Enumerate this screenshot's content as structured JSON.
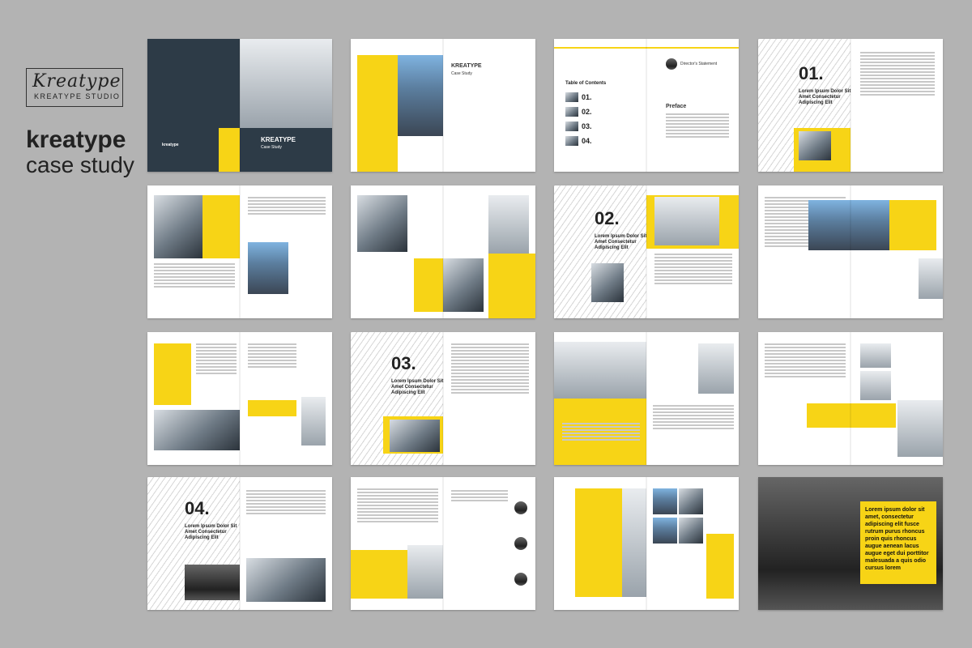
{
  "brand": {
    "logo_script": "Kreatype",
    "logo_sub": "KREATYPE STUDIO",
    "title_bold": "kreatype",
    "title_light": "case study"
  },
  "cover": {
    "name": "KREATYPE",
    "sub": "Case Study",
    "mini_brand": "kreatype"
  },
  "sections": [
    {
      "number": "01.",
      "heading": "Lorem Ipsum Dolor Sit Amet Consectetur Adipiscing Elit"
    },
    {
      "number": "02.",
      "heading": "Lorem Ipsum Dolor Sit Amet Consectetur Adipiscing Elit"
    },
    {
      "number": "03.",
      "heading": "Lorem Ipsum Dolor Sit Amet Consectetur Adipiscing Elit"
    },
    {
      "number": "04.",
      "heading": "Lorem Ipsum Dolor Sit Amet Consectetur Adipiscing Elit"
    }
  ],
  "toc": {
    "title": "Table of Contents",
    "items": [
      "01.",
      "02.",
      "03.",
      "04."
    ],
    "preface": "Preface",
    "director": "Director's Statement"
  },
  "quote_final": "Lorem ipsum dolor sit amet, consectetur adipiscing elit fusce rutrum purus rhoncus proin quis rhoncus augue aenean lacus augue eget dui porttitor malesuada a quis odio cursus lorem",
  "colors": {
    "accent": "#f7d416",
    "dark": "#2d3b47",
    "background": "#b3b3b3"
  }
}
